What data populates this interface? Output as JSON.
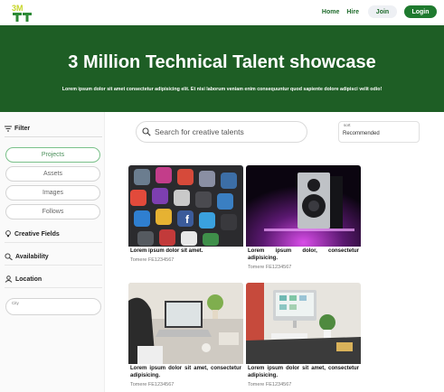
{
  "header": {
    "logo_text": "3M",
    "nav": {
      "home": "Home",
      "hire": "Hire",
      "join": "Join",
      "login": "Login"
    }
  },
  "hero": {
    "title": "3 Million Technical Talent showcase",
    "subtitle": "Lorem ipsum dolor sit amet consectetur adipisicing elit. Et nisi laborum veniam enim consequuntur quod sapiente dolore adipisci velit odio!"
  },
  "sidebar": {
    "filter_label": "Filter",
    "pills": [
      "Projects",
      "Assets",
      "Images",
      "Follows"
    ],
    "sections": [
      "Creative Fields",
      "Availability",
      "Location"
    ],
    "city_label": "City"
  },
  "search": {
    "placeholder": "Search for creative talents"
  },
  "sort": {
    "label": "sort",
    "value": "Recommended"
  },
  "cards": [
    {
      "title": "Lorem ipsum dolor sit amet.",
      "author": "Tomere FE1234567"
    },
    {
      "title": "Lorem ipsum dolor, consectetur adipisicing.",
      "author": "Tomere FE1234567"
    },
    {
      "title": "Lorem ipsum dolor sit amet, consectetur adipisicing.",
      "author": "Tomere FE1234567"
    },
    {
      "title": "Lorem ipsum dolor sit amet, consectetur adipisicing.",
      "author": "Tomere FE1234567"
    }
  ],
  "colors": {
    "brand_green": "#1e5e25",
    "accent_green": "#1f7a2f",
    "logo_yellow": "#c7d62a"
  }
}
